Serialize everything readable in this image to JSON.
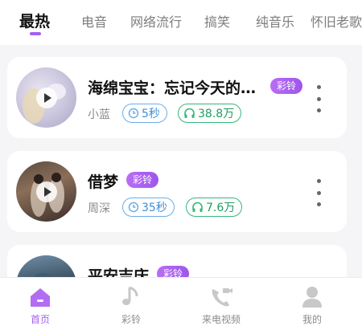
{
  "tabs": [
    {
      "label": "最热",
      "active": true
    },
    {
      "label": "电音"
    },
    {
      "label": "网络流行"
    },
    {
      "label": "搞笑"
    },
    {
      "label": "纯音乐"
    },
    {
      "label": "怀旧老歌"
    }
  ],
  "songs": [
    {
      "title": "海绵宝宝：忘记今天的…",
      "badge": "彩铃",
      "artist": "小蓝",
      "duration": "5秒",
      "listens": "38.8万"
    },
    {
      "title": "借梦",
      "badge": "彩铃",
      "artist": "周深",
      "duration": "35秒",
      "listens": "7.6万"
    },
    {
      "title": "平安吉庆",
      "badge": "彩铃"
    }
  ],
  "nav": [
    {
      "label": "首页",
      "icon": "home-icon",
      "active": true
    },
    {
      "label": "彩铃",
      "icon": "music-note-icon"
    },
    {
      "label": "来电视频",
      "icon": "phone-video-icon"
    },
    {
      "label": "我的",
      "icon": "user-icon"
    }
  ],
  "colors": {
    "accent": "#a45ff0",
    "duration_pill": "#6aaee8",
    "listen_pill": "#35b77a"
  }
}
